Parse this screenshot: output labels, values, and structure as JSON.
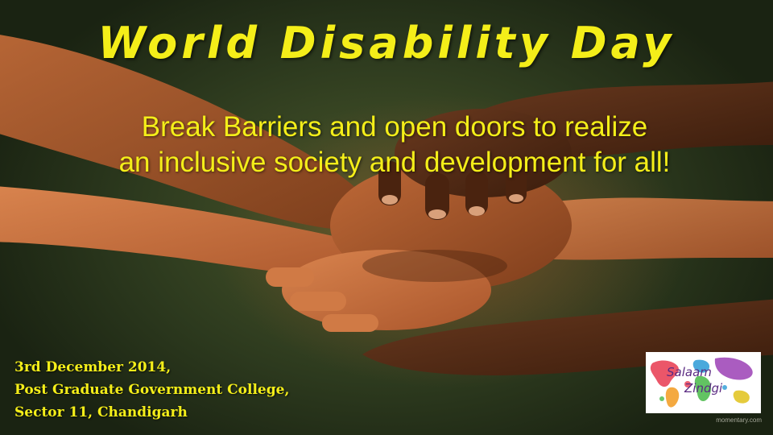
{
  "title": "World Disability Day",
  "subtitle": {
    "line1": "Break Barriers and open doors to realize",
    "line2": "an inclusive society and development for all!"
  },
  "event": {
    "date": "3rd December 2014,",
    "venue": "Post Graduate Government College,",
    "location": "Sector 11, Chandigarh"
  },
  "logo": {
    "line1": "Salaam",
    "line2": "Zindgi"
  },
  "watermark": "momentary.com",
  "colors": {
    "text_accent": "#f4ee19",
    "background": "#2d3a1e"
  },
  "icons": {
    "photo": "joined-hands-photo",
    "logo": "world-map-logo"
  }
}
